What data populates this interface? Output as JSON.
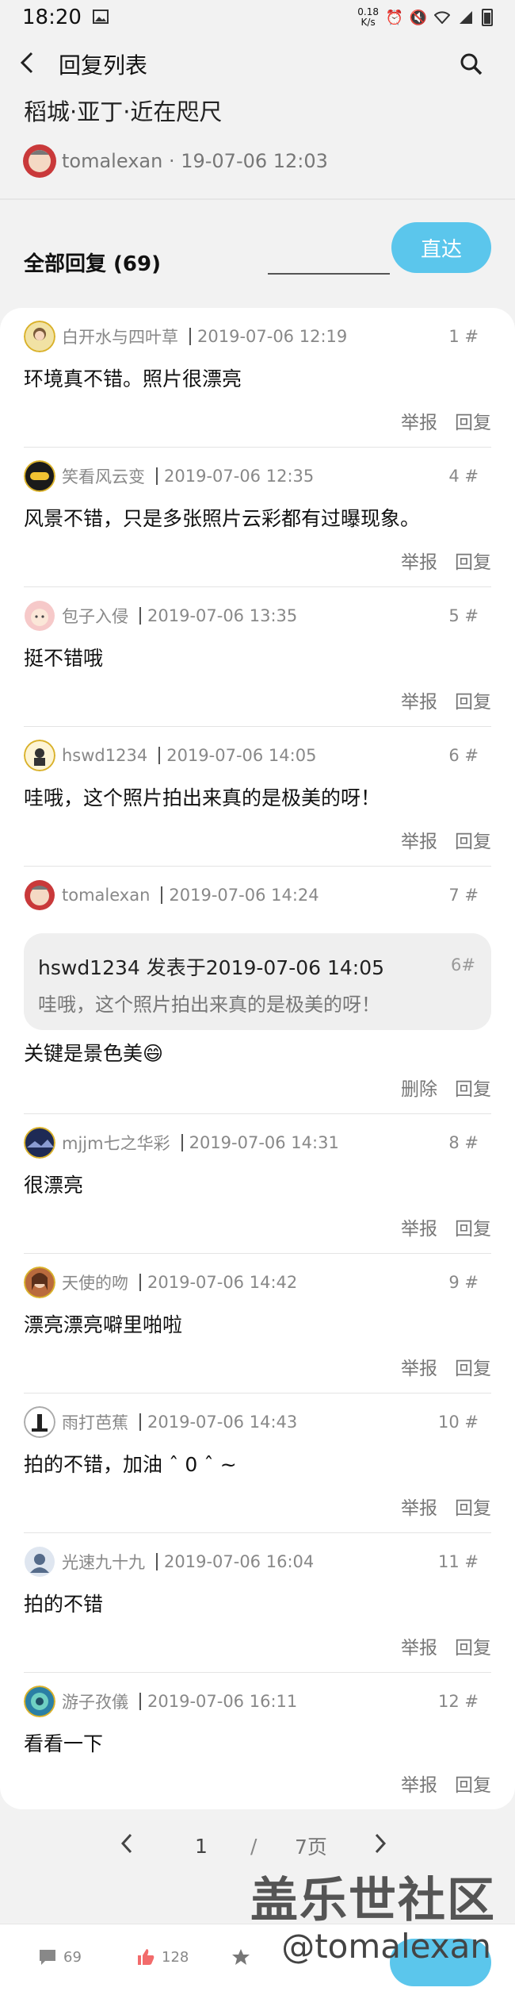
{
  "status_bar": {
    "time": "18:20",
    "speed_value": "0.18",
    "speed_unit": "K/s"
  },
  "nav": {
    "title": "回复列表"
  },
  "topic": {
    "title": "稻城·亚丁·近在咫尺",
    "author": "tomalexan",
    "posted": "19-07-06 12:03"
  },
  "replies_header": {
    "label": "全部回复 (69)",
    "jump_placeholder": "",
    "jump_button": "直达"
  },
  "replies": [
    {
      "user": "白开水与四叶草",
      "time": "2019-07-06 12:19",
      "floor": "1 #",
      "content": "环境真不错。照片很漂亮",
      "action1": "举报",
      "action2": "回复"
    },
    {
      "user": "笑看风云变",
      "time": "2019-07-06 12:35",
      "floor": "4 #",
      "content": "风景不错，只是多张照片云彩都有过曝现象。",
      "action1": "举报",
      "action2": "回复"
    },
    {
      "user": "包子入侵",
      "time": "2019-07-06 13:35",
      "floor": "5 #",
      "content": "挺不错哦",
      "action1": "举报",
      "action2": "回复"
    },
    {
      "user": "hswd1234",
      "time": "2019-07-06 14:05",
      "floor": "6 #",
      "content": "哇哦，这个照片拍出来真的是极美的呀！",
      "action1": "举报",
      "action2": "回复"
    },
    {
      "user": "tomalexan",
      "time": "2019-07-06 14:24",
      "floor": "7 #",
      "content": "关键是景色美😄",
      "action1": "删除",
      "action2": "回复",
      "quote": {
        "head": "hswd1234 发表于2019-07-06 14:05",
        "floor": "6#",
        "text": "哇哦，这个照片拍出来真的是极美的呀！"
      }
    },
    {
      "user": "mjjm七之华彩",
      "time": "2019-07-06 14:31",
      "floor": "8 #",
      "content": "很漂亮",
      "action1": "举报",
      "action2": "回复"
    },
    {
      "user": "天使的吻",
      "time": "2019-07-06 14:42",
      "floor": "9 #",
      "content": "漂亮漂亮噼里啪啦",
      "action1": "举报",
      "action2": "回复"
    },
    {
      "user": "雨打芭蕉",
      "time": "2019-07-06 14:43",
      "floor": "10 #",
      "content": "拍的不错，加油 ˆ 0 ˆ ~",
      "action1": "举报",
      "action2": "回复"
    },
    {
      "user": "光速九十九",
      "time": "2019-07-06 16:04",
      "floor": "11 #",
      "content": "拍的不错",
      "action1": "举报",
      "action2": "回复"
    },
    {
      "user": "游子孜儀",
      "time": "2019-07-06 16:11",
      "floor": "12 #",
      "content": "看看一下",
      "action1": "举报",
      "action2": "回复"
    }
  ],
  "pager": {
    "current": "1",
    "separator": "/",
    "total": "7页"
  },
  "watermark": {
    "site": "盖乐世社区",
    "handle": "@tomalexan"
  },
  "bottom_bar": {
    "comments": "69",
    "likes": "128"
  },
  "colors": {
    "accent": "#5bc6ec",
    "background": "#f2f2f2"
  }
}
